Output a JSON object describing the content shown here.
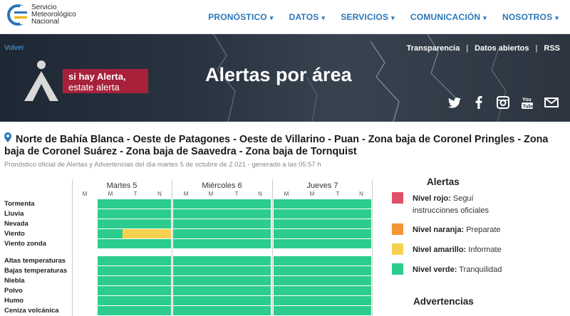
{
  "brand": {
    "line1": "Servicio",
    "line2": "Meteorológico",
    "line3": "Nacional",
    "color": "#2a76b8"
  },
  "nav": {
    "items": [
      {
        "label": "PRONÓSTICO",
        "caret": "▾"
      },
      {
        "label": "DATOS",
        "caret": "▾"
      },
      {
        "label": "SERVICIOS",
        "caret": "▾"
      },
      {
        "label": "COMUNICACIÓN",
        "caret": "▾"
      },
      {
        "label": "NOSOTROS",
        "caret": "▾"
      }
    ]
  },
  "banner": {
    "back_link": "Volver",
    "links": [
      "Transparencia",
      "Datos abiertos",
      "RSS"
    ],
    "separator": "|",
    "alert_line1": "si hay Alerta,",
    "alert_line2": "estate alerta",
    "title": "Alertas por área",
    "social_icons": [
      "twitter-icon",
      "facebook-icon",
      "instagram-icon",
      "youtube-icon",
      "email-icon"
    ]
  },
  "zone": {
    "name": "Norte de Bahía Blanca - Oeste de Patagones - Oeste de Villarino - Puan - Zona baja de Coronel Pringles - Zona baja de Coronel Suárez - Zona baja de Saavedra - Zona baja de Tornquist",
    "subtitle": "Pronóstico oficial de Alertas y Advertencias del día martes 5 de octubre de 2.021 - generado a las 05:57 h"
  },
  "grid": {
    "days": [
      "Martes 5",
      "Miércoles 6",
      "Jueves 7"
    ],
    "periods": [
      "M",
      "T",
      "N"
    ],
    "groups": [
      {
        "rows": [
          {
            "label": "Tormenta",
            "levels": [
              null,
              "verde",
              "verde",
              "verde",
              "verde",
              "verde",
              "verde",
              "verde",
              "verde"
            ]
          },
          {
            "label": "Lluvia",
            "levels": [
              null,
              "verde",
              "verde",
              "verde",
              "verde",
              "verde",
              "verde",
              "verde",
              "verde"
            ]
          },
          {
            "label": "Nevada",
            "levels": [
              null,
              "verde",
              "verde",
              "verde",
              "verde",
              "verde",
              "verde",
              "verde",
              "verde"
            ]
          },
          {
            "label": "Viento",
            "levels": [
              null,
              "verde",
              "amarillo",
              "amarillo",
              "verde",
              "verde",
              "verde",
              "verde",
              "verde"
            ]
          },
          {
            "label": "Viento zonda",
            "levels": [
              null,
              "verde",
              "verde",
              "verde",
              "verde",
              "verde",
              "verde",
              "verde",
              "verde"
            ]
          }
        ]
      },
      {
        "rows": [
          {
            "label": "Altas temperaturas",
            "levels": [
              null,
              "verde",
              "verde",
              "verde",
              "verde",
              "verde",
              "verde",
              "verde",
              "verde"
            ]
          },
          {
            "label": "Bajas temperaturas",
            "levels": [
              null,
              "verde",
              "verde",
              "verde",
              "verde",
              "verde",
              "verde",
              "verde",
              "verde"
            ]
          },
          {
            "label": "Niebla",
            "levels": [
              null,
              "verde",
              "verde",
              "verde",
              "verde",
              "verde",
              "verde",
              "verde",
              "verde"
            ]
          },
          {
            "label": "Polvo",
            "levels": [
              null,
              "verde",
              "verde",
              "verde",
              "verde",
              "verde",
              "verde",
              "verde",
              "verde"
            ]
          },
          {
            "label": "Humo",
            "levels": [
              null,
              "verde",
              "verde",
              "verde",
              "verde",
              "verde",
              "verde",
              "verde",
              "verde"
            ]
          },
          {
            "label": "Ceniza volcánica",
            "levels": [
              null,
              "verde",
              "verde",
              "verde",
              "verde",
              "verde",
              "verde",
              "verde",
              "verde"
            ]
          }
        ]
      }
    ]
  },
  "legend": {
    "alerts_title": "Alertas",
    "advertencias_title": "Advertencias",
    "items": [
      {
        "level": "rojo",
        "label": "Nivel rojo:",
        "text": "Seguí instrucciones oficiales"
      },
      {
        "level": "naranja",
        "label": "Nivel naranja:",
        "text": "Preparate"
      },
      {
        "level": "amarillo",
        "label": "Nivel amarillo:",
        "text": "Informate"
      },
      {
        "level": "verde",
        "label": "Nivel verde:",
        "text": "Tranquilidad"
      }
    ]
  },
  "colors": {
    "rojo": "#e0506a",
    "naranja": "#f29535",
    "amarillo": "#f6d150",
    "verde": "#2ccd8c",
    "accent": "#2a76b8"
  }
}
